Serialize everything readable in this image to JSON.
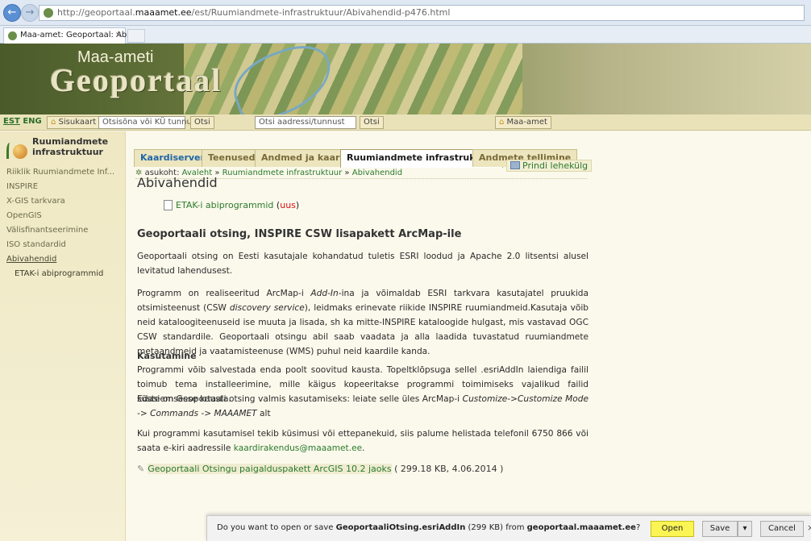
{
  "browser": {
    "url_prefix": "http://geoportaal.",
    "url_domain": "maaamet.ee",
    "url_path": "/est/Ruumiandmete-infrastruktuur/Abivahendid-p476.html",
    "tab_title": "Maa-amet: Geoportaal: Abi...",
    "tab_close": "×",
    "back_icon": "←",
    "forward_icon": "→"
  },
  "header": {
    "logo_top": "Maa-ameti",
    "logo_main": "Geoportaal"
  },
  "toolbar": {
    "lang_est": "EST",
    "lang_eng": "ENG",
    "sisukaart": "Sisukaart",
    "search_placeholder": "Otsisõna või KÜ tunnus",
    "otsi1": "Otsi",
    "address_placeholder": "Otsi aadressi/tunnust",
    "otsi2": "Otsi",
    "maa_amet": "Maa-amet"
  },
  "sidebar": {
    "title_line1": "Ruumiandmete",
    "title_line2": "infrastruktuur",
    "items": [
      {
        "label": "Riiklik Ruumiandmete Inf..."
      },
      {
        "label": "INSPIRE"
      },
      {
        "label": "X-GIS tarkvara"
      },
      {
        "label": "OpenGIS"
      },
      {
        "label": "Välisfinantseerimine"
      },
      {
        "label": "ISO standardid"
      },
      {
        "label": "Abivahendid"
      },
      {
        "label": "ETAK-i abiprogrammid"
      }
    ]
  },
  "tabs": [
    {
      "label": "Kaardiserver"
    },
    {
      "label": "Teenused"
    },
    {
      "label": "Andmed ja kaardid"
    },
    {
      "label": "Ruumiandmete infrastruktuur"
    },
    {
      "label": "Andmete tellimine"
    }
  ],
  "breadcrumb": {
    "prefix": "asukoht:",
    "home": "Avaleht",
    "sep": "»",
    "section": "Ruumiandmete infrastruktuur",
    "current": "Abivahendid"
  },
  "content": {
    "print_label": "Prindi lehekülg",
    "title": "Abivahendid",
    "doc_link": "ETAK-i abiprogrammid",
    "doc_new": "uus",
    "section_title": "Geoportaali otsing, INSPIRE CSW lisapakett ArcMap-ile",
    "p1": "Geoportaali otsing on Eesti kasutajale kohandatud tuletis ESRI loodud ja Apache 2.0 litsentsi alusel levitatud lahendusest.",
    "p2a": "Programm on realiseeritud ArcMap-i ",
    "p2_addin": "Add-In",
    "p2b": "-ina ja võimaldab ESRI tarkvara kasutajatel pruukida otsimisteenust (CSW ",
    "p2_csw": "discovery service",
    "p2c": "), leidmaks erinevate riikide INSPIRE ruumiandmeid.Kasutaja võib neid kataloogiteenuseid ise muuta ja lisada, sh ka mitte-INSPIRE kataloogide hulgast, mis vastavad OGC CSW standardile. Geoportaali otsingu abil saab vaadata ja alla laadida tuvastatud ruumiandmete metaandmeid ja vaatamisteenuse (WMS) puhul neid kaardile kanda.",
    "usage_title": "Kasutamine",
    "p3": "Programmi võib salvestada enda poolt soovitud kausta. Topeltklõpsuga sellel .esriAddIn laiendiga failil toimub tema installeerimine, mille käigus kopeeritakse programmi toimimiseks vajalikud failid süsteemsesse kausta.",
    "p4a": "Edasi on Geoportaali otsing valmis kasutamiseks: leiate selle üles ArcMap-i ",
    "p4_path": "Customize->Customize Mode -> Commands -> MAAAMET",
    "p4b": " alt",
    "p5": "Kui programmi kasutamisel tekib küsimusi või ettepanekuid, siis palume helistada telefonil 6750 866 või saata e-kiri aadressile ",
    "p5_email": "kaardirakendus@maaamet.ee",
    "p5_end": ".",
    "attach_link": "Geoportaali Otsingu paigalduspakett ArcGIS 10.2 jaoks",
    "attach_meta": "( 299.18 KB, 4.06.2014 )"
  },
  "download": {
    "msg_a": "Do you want to open or save ",
    "filename": "GeoportaaliOtsing.esriAddIn",
    "msg_b": " (299 KB) from ",
    "source": "geoportaal.maaamet.ee",
    "msg_c": "?",
    "open": "Open",
    "save": "Save",
    "arrow": "▾",
    "cancel": "Cancel",
    "close": "×"
  }
}
